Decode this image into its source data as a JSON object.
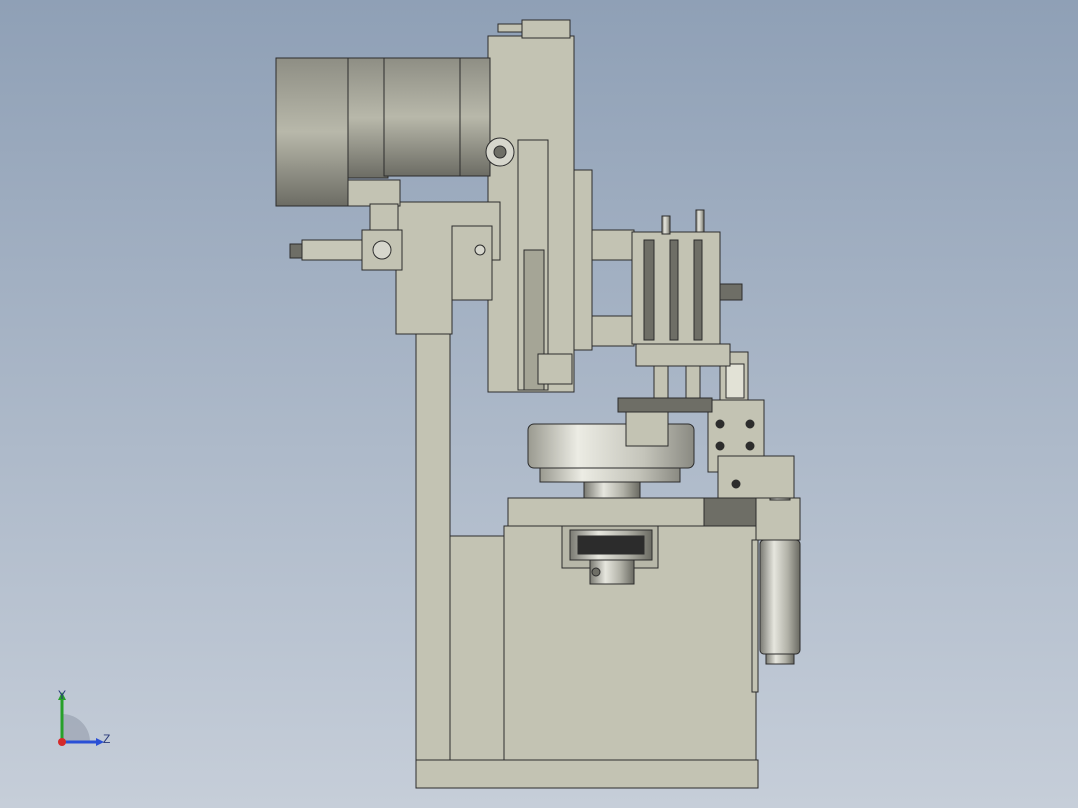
{
  "viewport": {
    "background_top": "#8fa0b6",
    "background_bottom": "#c6ced9"
  },
  "model": {
    "body_color": "#c3c3b3",
    "dark_color": "#6e6e66",
    "steel_color": "#d6d6cc",
    "edge_color": "#2c2c2c"
  },
  "triad": {
    "y_label": "Y",
    "z_label": "Z",
    "y_color": "#27a02a",
    "z_color": "#2a4fd6",
    "x_color": "#d42a2a"
  }
}
